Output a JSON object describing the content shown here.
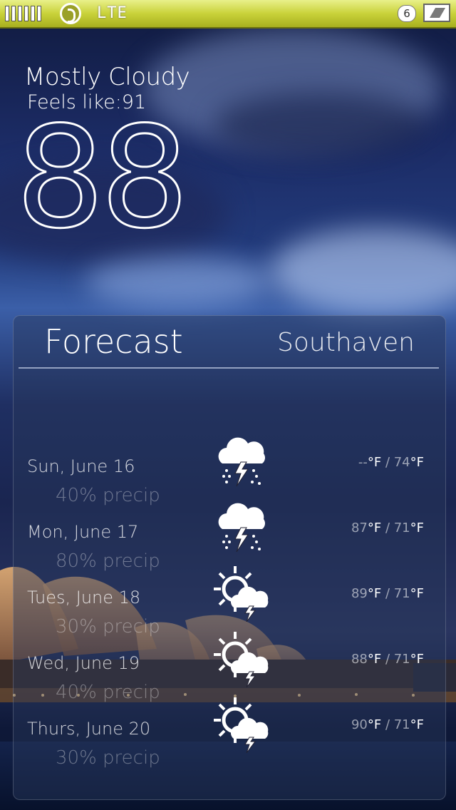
{
  "status_bar": {
    "network": "LTE",
    "notification_count": "6",
    "icons": [
      "signal-icon",
      "app-logo-icon",
      "chat-bubble-icon",
      "battery-charging-icon"
    ]
  },
  "current": {
    "condition": "Mostly Cloudy",
    "feels_like": "Feels like:91",
    "temperature": "88"
  },
  "forecast": {
    "title": "Forecast",
    "city": "Southaven",
    "days": [
      {
        "day": "Sun, June 16",
        "precip": "40% precip",
        "high": "--",
        "low": "74",
        "icon": "thunderstorm-rain-icon"
      },
      {
        "day": "Mon, June 17",
        "precip": "80% precip",
        "high": "87",
        "low": "71",
        "icon": "thunderstorm-rain-icon"
      },
      {
        "day": "Tues, June 18",
        "precip": "30% precip",
        "high": "89",
        "low": "71",
        "icon": "sun-cloud-thunder-icon"
      },
      {
        "day": "Wed, June 19",
        "precip": "40% precip",
        "high": "88",
        "low": "71",
        "icon": "sun-cloud-thunder-icon"
      },
      {
        "day": "Thurs, June 20",
        "precip": "30% precip",
        "high": "90",
        "low": "71",
        "icon": "sun-cloud-thunder-icon"
      }
    ],
    "unit": "°F",
    "separator": "/"
  },
  "colors": {
    "status_bar": "#c9d23a",
    "panel": "#28375a"
  }
}
